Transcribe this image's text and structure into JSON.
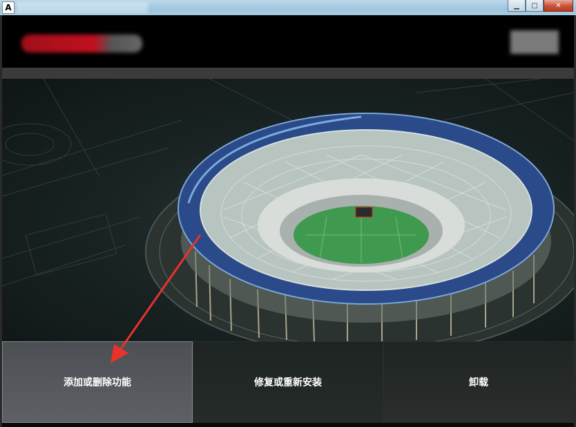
{
  "window": {
    "app_icon_glyph": "A",
    "controls": [
      "minimize-icon",
      "maximize-icon",
      "close-icon"
    ]
  },
  "actions": [
    {
      "label": "添加或删除功能"
    },
    {
      "label": "修复或重新安装"
    },
    {
      "label": "卸载"
    }
  ],
  "annotation": {
    "color": "#e8322c"
  },
  "colors": {
    "close_button": "#c9503a",
    "pitch": "#3f9a4f",
    "roof_band": "#2a4a8a"
  }
}
